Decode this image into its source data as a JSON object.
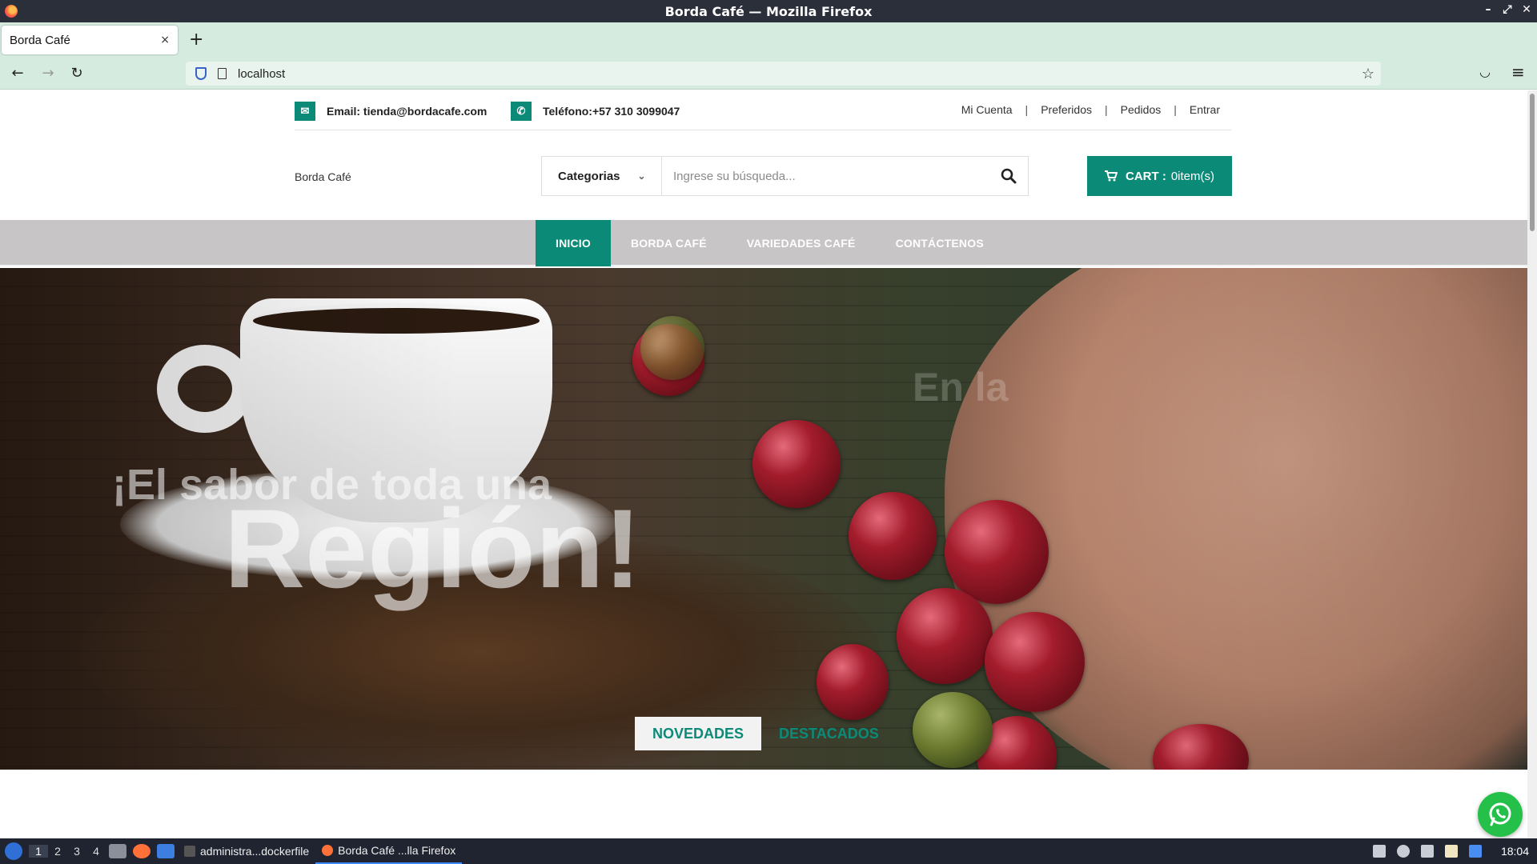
{
  "window": {
    "title": "Borda Café — Mozilla Firefox"
  },
  "browser": {
    "tab_title": "Borda Café",
    "tab_close": "×",
    "new_tab": "+",
    "url": "localhost",
    "back": "←",
    "forward": "→",
    "reload": "↻",
    "bookmark": "☆",
    "pocket": "◡",
    "menu": "≡"
  },
  "topinfo": {
    "email": "Email: tienda@bordacafe.com",
    "phone": "Teléfono:+57 310 3099047",
    "links": [
      "Mi Cuenta",
      "Preferidos",
      "Pedidos",
      "Entrar"
    ],
    "sep": "|"
  },
  "brand": "Borda Café",
  "search": {
    "category": "Categorias",
    "placeholder": "Ingrese su búsqueda..."
  },
  "cart": {
    "label": "CART :",
    "count": "0item(s)"
  },
  "menu": [
    "INICIO",
    "BORDA CAFÉ",
    "VARIEDADES CAFÉ",
    "CONTÁCTENOS"
  ],
  "hero": {
    "line1": "¡El sabor de toda una",
    "line2": "Región!",
    "line3": "En la"
  },
  "product_tabs": [
    "NOVEDADES",
    "DESTACADOS"
  ],
  "taskbar": {
    "workspaces": [
      "1",
      "2",
      "3",
      "4"
    ],
    "tasks": [
      "administra...dockerfile",
      "Borda Café ...lla Firefox"
    ],
    "clock": "18:04"
  },
  "colors": {
    "accent": "#0b8a78",
    "menubar": "#c7c5c5",
    "browser_chrome": "#d6ebdf"
  }
}
